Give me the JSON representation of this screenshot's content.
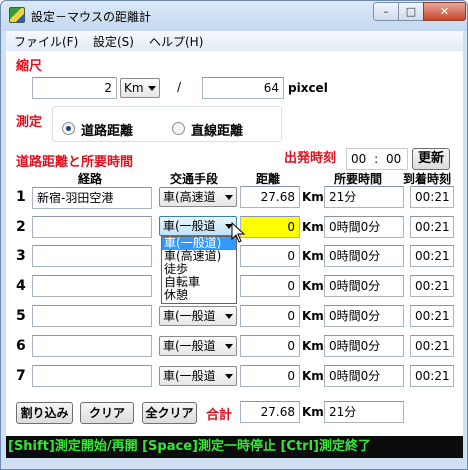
{
  "window": {
    "title": "設定－マウスの距離計",
    "minimize": "–",
    "maximize": "□",
    "close": "✕"
  },
  "menu": [
    "ファイル(F)",
    "設定(S)",
    "ヘルプ(H)"
  ],
  "scale": {
    "heading": "縮尺",
    "value": "2",
    "unit": "Km",
    "separator": "/",
    "pixels": "64",
    "pixel_label": "pixcel"
  },
  "measure": {
    "heading": "測定",
    "options": [
      "道路距離",
      "直線距離"
    ],
    "selected_index": 0
  },
  "section": {
    "heading": "道路距離と所要時間",
    "departure_label": "出発時刻",
    "departure_hour": "00",
    "departure_colon": ":",
    "departure_min": "00",
    "update_button": "更新"
  },
  "columns": [
    "経路",
    "交通手段",
    "距離",
    "所要時間",
    "到着時刻"
  ],
  "km_unit": "Km",
  "rows": [
    {
      "num": "1",
      "route": "新宿-羽田空港",
      "mode": "車(高速道",
      "distance": "27.68",
      "time": "21分",
      "arrival": "00:21"
    },
    {
      "num": "2",
      "route": "",
      "mode": "車(一般道",
      "distance": "0",
      "time": "0時間0分",
      "arrival": "00:21"
    },
    {
      "num": "3",
      "route": "",
      "mode": "",
      "distance": "0",
      "time": "0時間0分",
      "arrival": "00:21"
    },
    {
      "num": "4",
      "route": "",
      "mode": "",
      "distance": "0",
      "time": "0時間0分",
      "arrival": "00:21"
    },
    {
      "num": "5",
      "route": "",
      "mode": "車(一般道",
      "distance": "0",
      "time": "0時間0分",
      "arrival": "00:21"
    },
    {
      "num": "6",
      "route": "",
      "mode": "車(一般道",
      "distance": "0",
      "time": "0時間0分",
      "arrival": "00:21"
    },
    {
      "num": "7",
      "route": "",
      "mode": "車(一般道",
      "distance": "0",
      "time": "0時間0分",
      "arrival": "00:21"
    }
  ],
  "dropdown": {
    "options": [
      "車(一般道)",
      "車(高速道)",
      "徒歩",
      "自転車",
      "休憩"
    ],
    "selected_index": 0
  },
  "footer": {
    "interrupt_button": "割り込み",
    "clear_button": "クリア",
    "clear_all_button": "全クリア",
    "total_label": "合計",
    "total_distance": "27.68",
    "total_unit": "Km",
    "total_time": "21分"
  },
  "status": "[Shift]測定開始/再開 [Space]測定一時停止 [Ctrl]測定終了",
  "colors": {
    "accent_red": "#e0101f",
    "highlight_yellow": "#ffff00",
    "status_green": "#36e536",
    "selection_blue": "#3399ff"
  }
}
